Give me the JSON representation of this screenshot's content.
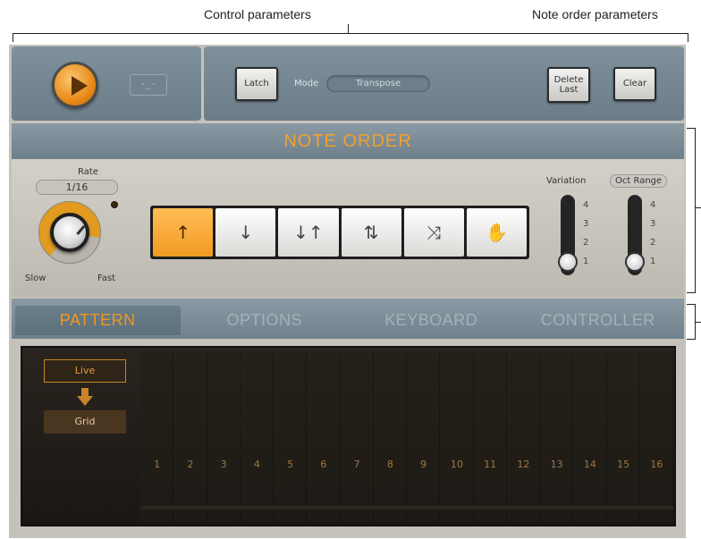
{
  "annotations": {
    "control_parameters": "Control parameters",
    "note_order_parameters": "Note order parameters"
  },
  "header": {
    "mode_label": "Mode",
    "mode_value": "Transpose",
    "latch_label": "Latch",
    "delete_last_line1": "Delete",
    "delete_last_line2": "Last",
    "clear_label": "Clear"
  },
  "note_order": {
    "title": "NOTE ORDER",
    "rate_label": "Rate",
    "rate_value": "1/16",
    "slow_label": "Slow",
    "fast_label": "Fast",
    "order_buttons": [
      {
        "icon": "arrow-up-icon",
        "glyph": "↑",
        "active": true
      },
      {
        "icon": "arrow-down-icon",
        "glyph": "↓",
        "active": false
      },
      {
        "icon": "down-up-arrows-icon",
        "glyph": "↓↑",
        "active": false
      },
      {
        "icon": "converge-arrows-icon",
        "glyph": "⇅",
        "active": false
      },
      {
        "icon": "random-shuffle-icon",
        "glyph": "⤨",
        "active": false
      },
      {
        "icon": "hand-icon",
        "glyph": "✋",
        "active": false
      }
    ],
    "variation_label": "Variation",
    "oct_range_label": "Oct Range",
    "scale": [
      "4",
      "3",
      "2",
      "1"
    ],
    "variation_value": 1,
    "oct_range_value": 1
  },
  "tabs": [
    {
      "label": "PATTERN",
      "active": true
    },
    {
      "label": "OPTIONS",
      "active": false
    },
    {
      "label": "KEYBOARD",
      "active": false
    },
    {
      "label": "CONTROLLER",
      "active": false
    }
  ],
  "pattern": {
    "live_label": "Live",
    "grid_label": "Grid",
    "steps": [
      "1",
      "2",
      "3",
      "4",
      "5",
      "6",
      "7",
      "8",
      "9",
      "10",
      "11",
      "12",
      "13",
      "14",
      "15",
      "16"
    ]
  },
  "colors": {
    "accent": "#f2961e",
    "panel": "#7f919c",
    "body": "#c5c2bb"
  }
}
